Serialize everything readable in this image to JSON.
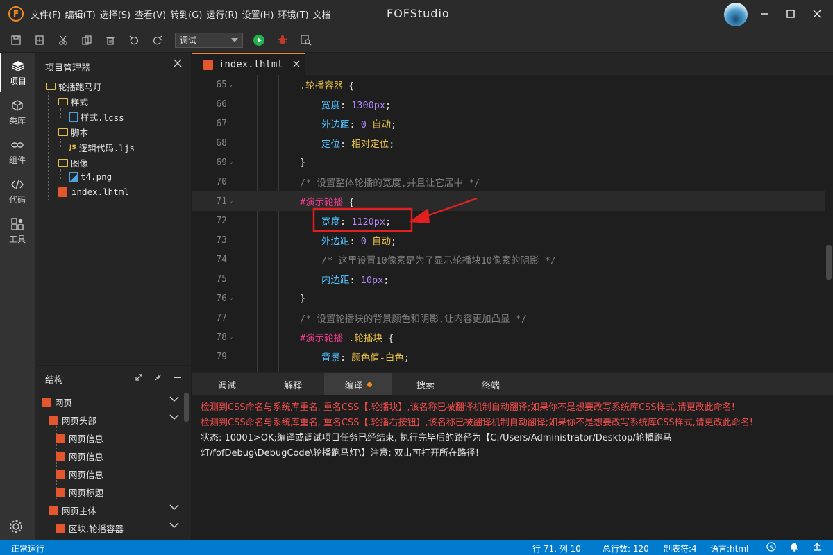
{
  "app": {
    "title": "FOFStudio",
    "logo_letter": "F",
    "menu": [
      "文件(F)",
      "编辑(T)",
      "选择(S)",
      "查看(V)",
      "转到(G)",
      "运行(R)",
      "设置(H)",
      "环境(T)",
      "文档"
    ]
  },
  "toolbar": {
    "mode_value": "调试"
  },
  "activity": [
    {
      "label": "项目",
      "icon": "layers-icon"
    },
    {
      "label": "类库",
      "icon": "cube-icon"
    },
    {
      "label": "组件",
      "icon": "link-icon"
    },
    {
      "label": "代码",
      "icon": "code-icon"
    },
    {
      "label": "工具",
      "icon": "tools-icon"
    }
  ],
  "project": {
    "title": "项目管理器",
    "root": "轮播跑马灯",
    "items": [
      {
        "label": "样式",
        "kind": "folder"
      },
      {
        "label": "样式.lcss",
        "kind": "file"
      },
      {
        "label": "脚本",
        "kind": "folder"
      },
      {
        "label": "逻辑代码.ljs",
        "kind": "js"
      },
      {
        "label": "图像",
        "kind": "folder"
      },
      {
        "label": "t4.png",
        "kind": "image"
      },
      {
        "label": "index.lhtml",
        "kind": "html"
      }
    ]
  },
  "structure": {
    "title": "结构",
    "items": [
      "网页",
      "网页头部",
      "网页信息",
      "网页信息",
      "网页信息",
      "网页标题",
      "网页主体",
      "区块.轮播容器"
    ]
  },
  "editor": {
    "tab": "index.lhtml",
    "lines": [
      {
        "n": "65",
        "fold": "⌄",
        "parts": [
          {
            "t": ".轮播容器 ",
            "c": "sel"
          },
          {
            "t": "{",
            "c": "brace"
          }
        ]
      },
      {
        "n": "66",
        "parts": [
          {
            "t": "宽度",
            "c": "prop"
          },
          {
            "t": ": ",
            "c": "brace"
          },
          {
            "t": "1300px",
            "c": "num"
          },
          {
            "t": ";",
            "c": "brace"
          }
        ]
      },
      {
        "n": "67",
        "parts": [
          {
            "t": "外边距",
            "c": "prop"
          },
          {
            "t": ": ",
            "c": "brace"
          },
          {
            "t": "0 ",
            "c": "num"
          },
          {
            "t": "自动",
            "c": "kw"
          },
          {
            "t": ";",
            "c": "brace"
          }
        ]
      },
      {
        "n": "68",
        "parts": [
          {
            "t": "定位",
            "c": "prop"
          },
          {
            "t": ": ",
            "c": "brace"
          },
          {
            "t": "相对定位",
            "c": "kw"
          },
          {
            "t": ";",
            "c": "brace"
          }
        ]
      },
      {
        "n": "69",
        "fold": "⌄",
        "parts": [
          {
            "t": "}",
            "c": "brace"
          }
        ]
      },
      {
        "n": "70",
        "parts": [
          {
            "t": "/* 设置整体轮播的宽度,并且让它居中 */",
            "c": "cm"
          }
        ]
      },
      {
        "n": "71",
        "fold": "⌄",
        "active": true,
        "parts": [
          {
            "t": "#演示轮播 ",
            "c": "idsel"
          },
          {
            "t": "{",
            "c": "brace"
          }
        ]
      },
      {
        "n": "72",
        "parts": [
          {
            "t": "宽度",
            "c": "prop"
          },
          {
            "t": ": ",
            "c": "brace"
          },
          {
            "t": "1120px",
            "c": "num"
          },
          {
            "t": ";",
            "c": "brace"
          }
        ]
      },
      {
        "n": "73",
        "parts": [
          {
            "t": "外边距",
            "c": "prop"
          },
          {
            "t": ": ",
            "c": "brace"
          },
          {
            "t": "0 ",
            "c": "num"
          },
          {
            "t": "自动",
            "c": "kw"
          },
          {
            "t": ";",
            "c": "brace"
          }
        ]
      },
      {
        "n": "74",
        "parts": [
          {
            "t": "/* 这里设置10像素是为了显示轮播块10像素的阴影 */",
            "c": "cm"
          }
        ]
      },
      {
        "n": "75",
        "parts": [
          {
            "t": "内边距",
            "c": "prop"
          },
          {
            "t": ": ",
            "c": "brace"
          },
          {
            "t": "10px",
            "c": "num"
          },
          {
            "t": ";",
            "c": "brace"
          }
        ]
      },
      {
        "n": "76",
        "fold": "⌄",
        "parts": [
          {
            "t": "}",
            "c": "brace"
          }
        ]
      },
      {
        "n": "77",
        "parts": [
          {
            "t": "/* 设置轮播块的背景颜色和阴影,让内容更加凸显 */",
            "c": "cm"
          }
        ]
      },
      {
        "n": "78",
        "fold": "⌄",
        "parts": [
          {
            "t": "#演示轮播 ",
            "c": "idsel"
          },
          {
            "t": ".轮播块 ",
            "c": "sel"
          },
          {
            "t": "{",
            "c": "brace"
          }
        ]
      },
      {
        "n": "79",
        "parts": [
          {
            "t": "背景",
            "c": "prop"
          },
          {
            "t": ": ",
            "c": "brace"
          },
          {
            "t": "颜色值-白色",
            "c": "kw"
          },
          {
            "t": ";",
            "c": "brace"
          }
        ]
      }
    ]
  },
  "panel": {
    "tabs": [
      "调试",
      "解释",
      "编译",
      "搜索",
      "终端"
    ],
    "active_tab": 2,
    "output": [
      {
        "text": "检测到CSS命名与系统库重名, 重名CSS【.轮播块】,该名称已被翻译机制自动翻译;如果你不是想要改写系统库CSS样式,请更改此命名!",
        "kind": "err"
      },
      {
        "text": "检测到CSS命名与系统库重名, 重名CSS【.轮播右按钮】,该名称已被翻译机制自动翻译;如果你不是想要改写系统库CSS样式,请更改此命名!",
        "kind": "err"
      },
      {
        "text": "状态: 10001>OK;编译或调试项目任务已经结束, 执行完毕后的路径为【C:/Users/Administrator/Desktop/轮播跑马",
        "kind": "ok"
      },
      {
        "text": "灯/fofDebug\\DebugCode\\轮播跑马灯\\】注意: 双击可打开所在路径!",
        "kind": "ok"
      }
    ]
  },
  "status": {
    "left": "正常运行",
    "position": "行 71, 列 10",
    "total_lines": "总行数: 120",
    "tab_size": "制表符:4",
    "language": "语言:html"
  },
  "colors": {
    "accent": "#f08a24",
    "statusbar": "#007acc",
    "error": "#f14c4c",
    "annotation": "#e02020"
  }
}
